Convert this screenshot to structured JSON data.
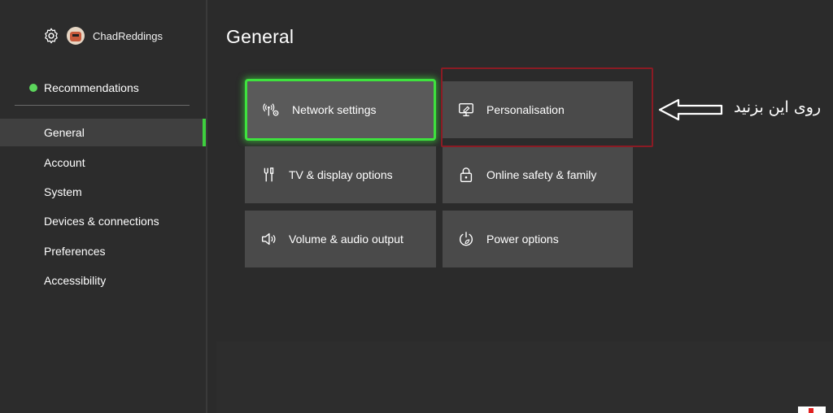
{
  "profile": {
    "username": "ChadReddings",
    "icons": [
      "gear-icon",
      "avatar"
    ]
  },
  "sidebar": {
    "recommendations": "Recommendations",
    "items": [
      {
        "label": "General",
        "active": true
      },
      {
        "label": "Account"
      },
      {
        "label": "System"
      },
      {
        "label": "Devices & connections"
      },
      {
        "label": "Preferences"
      },
      {
        "label": "Accessibility"
      }
    ]
  },
  "page": {
    "title": "General"
  },
  "tiles": [
    {
      "label": "Network settings",
      "icon": "network-icon",
      "focused": true
    },
    {
      "label": "Personalisation",
      "icon": "personalisation-icon"
    },
    {
      "label": "TV & display options",
      "icon": "tv-display-icon"
    },
    {
      "label": "Online safety & family",
      "icon": "lock-icon"
    },
    {
      "label": "Volume & audio output",
      "icon": "speaker-icon"
    },
    {
      "label": "Power options",
      "icon": "power-icon"
    }
  ],
  "annotation": {
    "text": "روی این بزنید"
  },
  "colors": {
    "accent": "#3ee23e",
    "annotation_box": "#8b1b24",
    "background": "#2b2b2b",
    "tile": "#4a4a4a"
  }
}
